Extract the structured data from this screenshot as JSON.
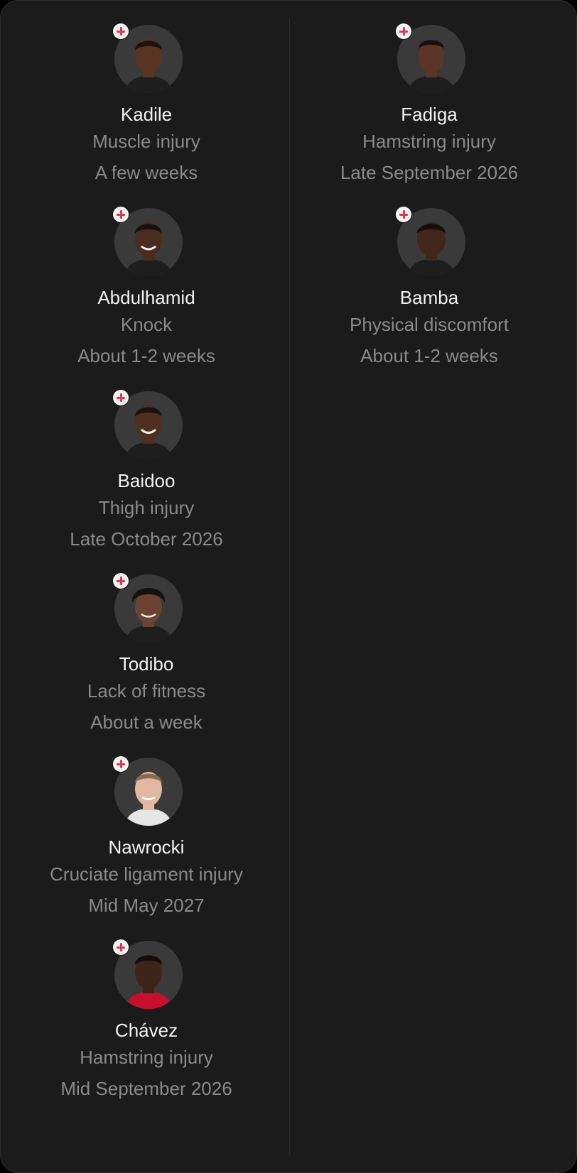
{
  "injury_list": {
    "left_column": [
      {
        "name": "Kadile",
        "reason": "Muscle injury",
        "expected_return": "A few weeks",
        "icon": "injury-cross-icon"
      },
      {
        "name": "Abdulhamid",
        "reason": "Knock",
        "expected_return": "About 1-2 weeks",
        "icon": "injury-cross-icon"
      },
      {
        "name": "Baidoo",
        "reason": "Thigh injury",
        "expected_return": "Late October 2026",
        "icon": "injury-cross-icon"
      },
      {
        "name": "Todibo",
        "reason": "Lack of fitness",
        "expected_return": "About a week",
        "icon": "injury-cross-icon"
      },
      {
        "name": "Nawrocki",
        "reason": "Cruciate ligament injury",
        "expected_return": "Mid May 2027",
        "icon": "injury-cross-icon"
      },
      {
        "name": "Chávez",
        "reason": "Hamstring injury",
        "expected_return": "Mid September 2026",
        "icon": "injury-cross-icon"
      }
    ],
    "right_column": [
      {
        "name": "Fadiga",
        "reason": "Hamstring injury",
        "expected_return": "Late September 2026",
        "icon": "injury-cross-icon"
      },
      {
        "name": "Bamba",
        "reason": "Physical discomfort",
        "expected_return": "About 1-2 weeks",
        "icon": "injury-cross-icon"
      }
    ]
  },
  "colors": {
    "panel_background": "#1b1b1b",
    "name_text": "#f2f2f2",
    "secondary_text": "#8a8a8a",
    "badge_background": "#f4f4f4",
    "badge_cross": "#e8344a"
  }
}
